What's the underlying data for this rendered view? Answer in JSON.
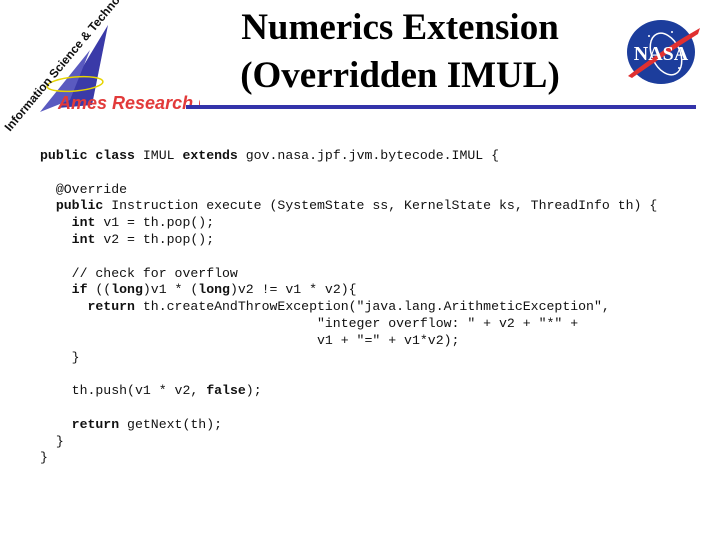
{
  "header": {
    "title_line1": "Numerics Extension",
    "title_line2": "(Overridden IMUL)",
    "logo_left": {
      "arc_text": "Information Science & Technology",
      "center_text": "Ames Research Center"
    },
    "logo_right": {
      "text": "NASA"
    },
    "colors": {
      "rule": "#3333aa",
      "ames_red": "#e23a3a",
      "nasa_blue": "#1c3d9c",
      "nasa_red": "#e03030"
    }
  },
  "code": {
    "language": "java",
    "lines": [
      [
        {
          "t": "public class",
          "b": true
        },
        {
          "t": " IMUL "
        },
        {
          "t": "extends",
          "b": true
        },
        {
          "t": " gov.nasa.jpf.jvm.bytecode.IMUL {"
        }
      ],
      [],
      [
        {
          "t": "  @Override"
        }
      ],
      [
        {
          "t": "  "
        },
        {
          "t": "public",
          "b": true
        },
        {
          "t": " Instruction execute (SystemState ss, KernelState ks, ThreadInfo th) {"
        }
      ],
      [
        {
          "t": "    "
        },
        {
          "t": "int",
          "b": true
        },
        {
          "t": " v1 = th.pop();"
        }
      ],
      [
        {
          "t": "    "
        },
        {
          "t": "int",
          "b": true
        },
        {
          "t": " v2 = th.pop();"
        }
      ],
      [],
      [
        {
          "t": "    // check for overflow"
        }
      ],
      [
        {
          "t": "    "
        },
        {
          "t": "if",
          "b": true
        },
        {
          "t": " (("
        },
        {
          "t": "long",
          "b": true
        },
        {
          "t": ")v1 * ("
        },
        {
          "t": "long",
          "b": true
        },
        {
          "t": ")v2 != v1 * v2){"
        }
      ],
      [
        {
          "t": "      "
        },
        {
          "t": "return",
          "b": true
        },
        {
          "t": " th.createAndThrowException(\"java.lang.ArithmeticException\","
        }
      ],
      [
        {
          "t": "                                   \"integer overflow: \" + v2 + \"*\" +"
        }
      ],
      [
        {
          "t": "                                   v1 + \"=\" + v1*v2);"
        }
      ],
      [
        {
          "t": "    }"
        }
      ],
      [],
      [
        {
          "t": "    th.push(v1 * v2, "
        },
        {
          "t": "false",
          "b": true
        },
        {
          "t": ");"
        }
      ],
      [],
      [
        {
          "t": "    "
        },
        {
          "t": "return",
          "b": true
        },
        {
          "t": " getNext(th);"
        }
      ],
      [
        {
          "t": "  }"
        }
      ],
      [
        {
          "t": "}"
        }
      ]
    ]
  }
}
